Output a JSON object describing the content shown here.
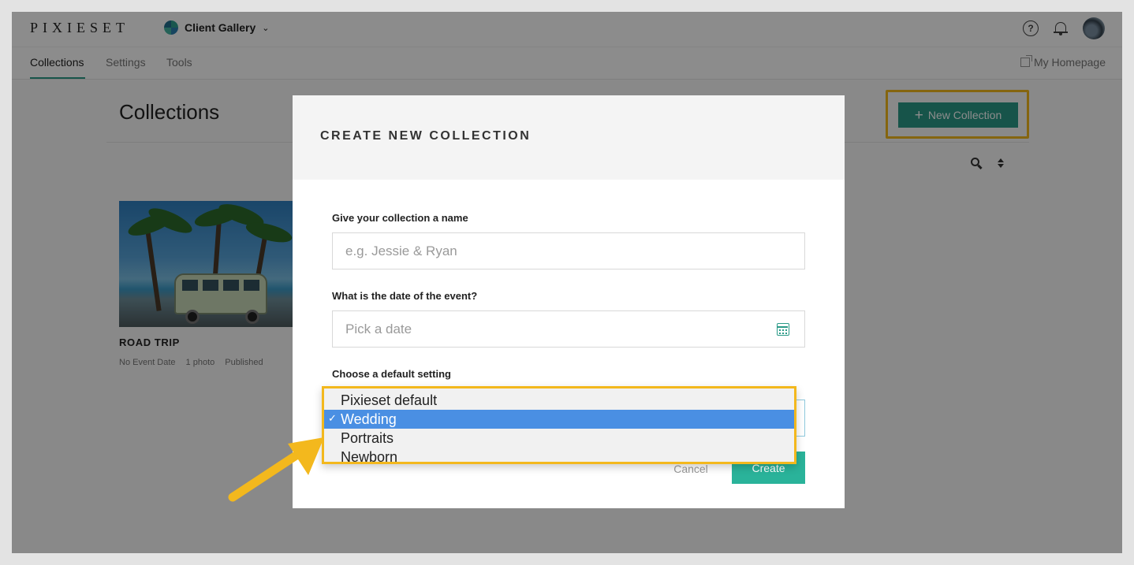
{
  "topbar": {
    "logo": "PIXIESET",
    "gallery_label": "Client Gallery",
    "icons": [
      "help-icon",
      "bell-icon",
      "avatar"
    ]
  },
  "nav": {
    "tabs": [
      {
        "label": "Collections",
        "active": true
      },
      {
        "label": "Settings",
        "active": false
      },
      {
        "label": "Tools",
        "active": false
      }
    ],
    "homepage_label": "My Homepage"
  },
  "page": {
    "title": "Collections",
    "new_collection_label": "New Collection"
  },
  "collection_card": {
    "title": "ROAD TRIP",
    "event_date": "No Event Date",
    "photo_count": "1 photo",
    "status": "Published"
  },
  "modal": {
    "title": "CREATE NEW COLLECTION",
    "name_label": "Give your collection a name",
    "name_placeholder": "e.g. Jessie & Ryan",
    "date_label": "What is the date of the event?",
    "date_placeholder": "Pick a date",
    "setting_label": "Choose a default setting",
    "cancel_label": "Cancel",
    "create_label": "Create"
  },
  "dropdown": {
    "options": [
      "Pixieset default",
      "Wedding",
      "Portraits",
      "Newborn"
    ],
    "selected": "Wedding",
    "check": "✓"
  },
  "colors": {
    "accent": "#2a9a87",
    "highlight": "#f3b81d",
    "selected_option": "#4a8fe3"
  }
}
